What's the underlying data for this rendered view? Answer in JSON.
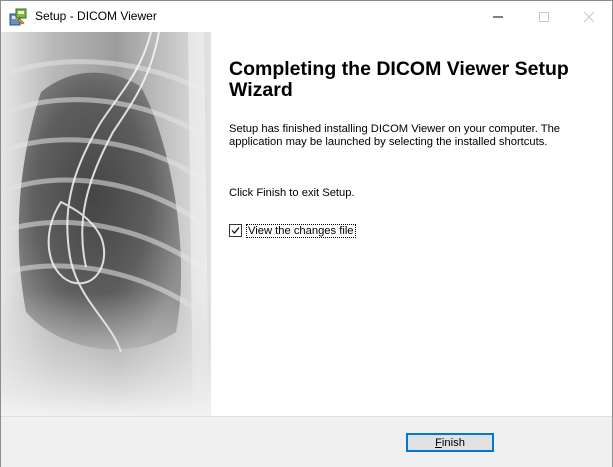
{
  "window": {
    "title": "Setup - DICOM Viewer",
    "icon": "installer-icon"
  },
  "title_buttons": {
    "minimize_icon": "minimize-icon",
    "maximize_icon": "maximize-icon",
    "close_icon": "close-icon"
  },
  "sidepanel": {
    "image": "chest-x-ray-image"
  },
  "content": {
    "heading": "Completing the DICOM Viewer Setup Wizard",
    "description": "Setup has finished installing DICOM Viewer on your computer. The application may be launched by selecting the installed shortcuts.",
    "finish_note": "Click Finish to exit Setup."
  },
  "checkbox": {
    "label": "View the changes file",
    "checked": true
  },
  "footer": {
    "finish_label": "Finish",
    "finish_access_key": "F"
  },
  "colors": {
    "accent": "#0078d7",
    "footer_bg": "#f0f0f0"
  }
}
